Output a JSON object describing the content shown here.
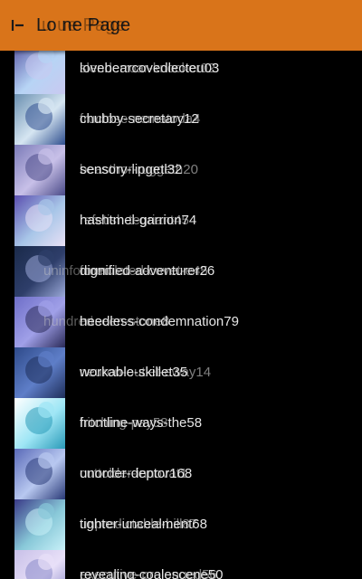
{
  "appbar": {
    "title": "Lo   ne   Page",
    "title_ghost": "u  ue   Page",
    "back_icon": "back-arrow-icon",
    "color": "#d9741a"
  },
  "users": [
    {
      "primary": "lovebearcovedlecteu03",
      "secondary": "slenderroar-knocker02",
      "thumb": [
        "#5a5aa8",
        "#b7d4f5",
        "#c9c9f0"
      ]
    },
    {
      "primary": "chubby-secretary12",
      "secondary": "fructose-nematoda4",
      "thumb": [
        "#6a8fb0",
        "#d6e6f2",
        "#2f4f8f"
      ]
    },
    {
      "primary": "sensory-lipgetl32",
      "secondary": "beasthor-ruggeth20",
      "thumb": [
        "#7b7bb8",
        "#c8c0e8",
        "#4a4a88"
      ]
    },
    {
      "primary": "hashtmel-garrion74",
      "secondary": "refetish-tegriant45",
      "thumb": [
        "#5b4fb0",
        "#a8c6e8",
        "#e8e0f5"
      ]
    },
    {
      "primary": "dignified-adventurer26",
      "secondary": "formulated-covet-e45",
      "ghost": "uninformed",
      "thumb": [
        "#1a2a4a",
        "#2e3e6a",
        "#9aa8d8"
      ]
    },
    {
      "primary": "heedless-condemnation79",
      "secondary": "unseen-stone8",
      "ghost": "hundred",
      "thumb": [
        "#6e6ec8",
        "#a0a0e8",
        "#2a2a58"
      ]
    },
    {
      "primary": "workable-skillet35",
      "secondary": "neuron-outlet-eway14",
      "thumb": [
        "#2e4a8a",
        "#5e7ec8",
        "#1e2e5a"
      ]
    },
    {
      "primary": "frontline-ways-the58",
      "secondary": "hitching-pay58",
      "thumb": [
        "#ffffff",
        "#9ee6f5",
        "#2a9ab8"
      ]
    },
    {
      "primary": "unorder-deptor168",
      "secondary": "cuttolder-innovat1",
      "thumb": [
        "#5a6ab8",
        "#b8c8f0",
        "#2a3a78"
      ]
    },
    {
      "primary": "tighter-uncealment68",
      "secondary": "unpredictable-bill87",
      "thumb": [
        "#3a3a88",
        "#88c8d8",
        "#c8f0f8"
      ]
    },
    {
      "primary": "revealing-coalescene50",
      "secondary": "executive-prolonged56",
      "thumb": [
        "#c8c0e8",
        "#e8e0f8",
        "#8888c8"
      ]
    }
  ]
}
